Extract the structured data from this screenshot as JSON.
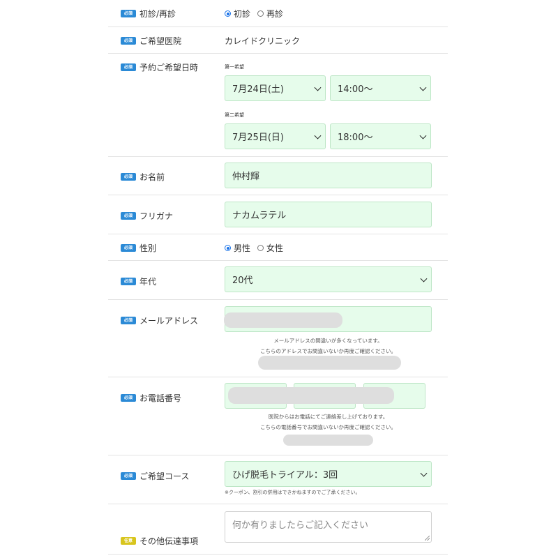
{
  "badges": {
    "required": "必須",
    "optional": "任意"
  },
  "rows": {
    "visit_type": {
      "label": "初診/再診",
      "options": [
        "初診",
        "再診"
      ],
      "selected": 0
    },
    "clinic": {
      "label": "ご希望医院",
      "value": "カレイドクリニック"
    },
    "datetime": {
      "label": "予約ご希望日時",
      "first_label": "第一希望",
      "first_date": "7月24日(土)",
      "first_time": "14:00〜",
      "second_label": "第二希望",
      "second_date": "7月25日(日)",
      "second_time": "18:00〜"
    },
    "name": {
      "label": "お名前",
      "value": "仲村輝"
    },
    "kana": {
      "label": "フリガナ",
      "value": "ナカムラテル"
    },
    "gender": {
      "label": "性別",
      "options": [
        "男性",
        "女性"
      ],
      "selected": 0
    },
    "age": {
      "label": "年代",
      "value": "20代"
    },
    "email": {
      "label": "メールアドレス",
      "note1": "メールアドレスの間違いが多くなっています。",
      "note2": "こちらのアドレスでお間違いないか再度ご確認ください。"
    },
    "phone": {
      "label": "お電話番号",
      "note1": "医院からはお電話にてご連絡差し上げております。",
      "note2": "こちらの電話番号でお間違いないか再度ご確認ください。"
    },
    "course": {
      "label": "ご希望コース",
      "value": "ひげ脱毛トライアル：3回",
      "note": "※クーポン、割引の併用はできかねますのでご了承ください。"
    },
    "message": {
      "label": "その他伝達事項",
      "placeholder": "何か有りましたらご記入ください"
    }
  }
}
